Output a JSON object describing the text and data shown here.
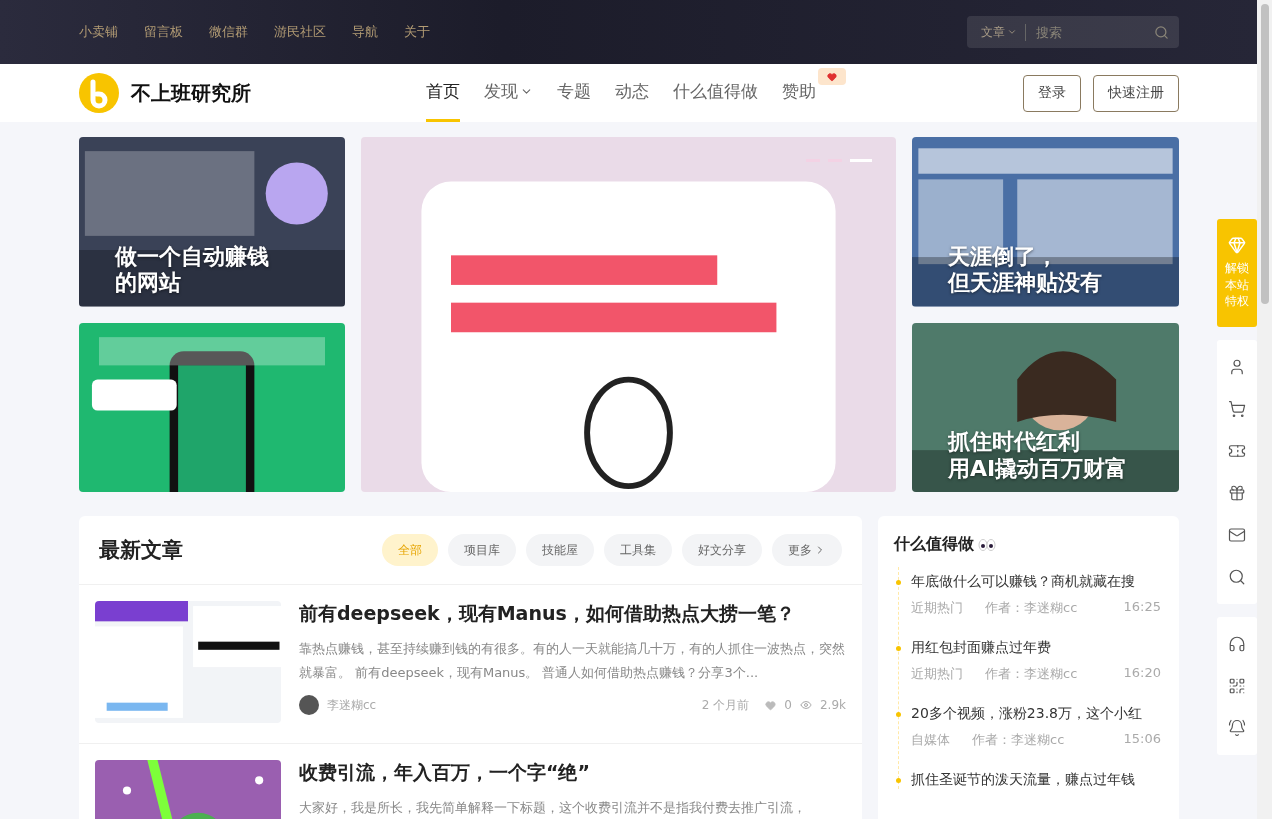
{
  "top_links": [
    {
      "label": "小卖铺"
    },
    {
      "label": "留言板"
    },
    {
      "label": "微信群"
    },
    {
      "label": "游民社区"
    },
    {
      "label": "导航"
    },
    {
      "label": "关于"
    }
  ],
  "search": {
    "scope": "文章",
    "placeholder": "搜索"
  },
  "brand": {
    "name": "不上班研究所"
  },
  "nav": [
    {
      "label": "首页",
      "selected": true,
      "dropdown": false,
      "badge": false
    },
    {
      "label": "发现",
      "selected": false,
      "dropdown": true,
      "badge": false
    },
    {
      "label": "专题",
      "selected": false,
      "dropdown": false,
      "badge": false
    },
    {
      "label": "动态",
      "selected": false,
      "dropdown": false,
      "badge": false
    },
    {
      "label": "什么值得做",
      "selected": false,
      "dropdown": false,
      "badge": false
    },
    {
      "label": "赞助",
      "selected": false,
      "dropdown": false,
      "badge": true
    }
  ],
  "auth_buttons": [
    {
      "label": "登录"
    },
    {
      "label": "快速注册"
    }
  ],
  "banners": {
    "left": [
      {
        "kind": "titled",
        "title_lines": [
          "做一个自动赚钱",
          "的网站"
        ]
      },
      {
        "kind": "picture"
      }
    ],
    "center": {
      "slides": [
        {
          "selected": false
        },
        {
          "selected": false
        },
        {
          "selected": true
        }
      ]
    },
    "right": [
      {
        "kind": "titled",
        "title_lines": [
          "天涯倒了，",
          "但天涯神贴没有"
        ]
      },
      {
        "kind": "titled",
        "title_lines": [
          "抓住时代红利",
          "用AI撬动百万财富"
        ]
      }
    ]
  },
  "latest": {
    "title": "最新文章",
    "filters": [
      {
        "label": "全部",
        "selected": true
      },
      {
        "label": "项目库",
        "selected": false
      },
      {
        "label": "技能屋",
        "selected": false
      },
      {
        "label": "工具集",
        "selected": false
      },
      {
        "label": "好文分享",
        "selected": false
      },
      {
        "label": "更多",
        "selected": false
      }
    ],
    "articles": [
      {
        "title": "前有deepseek，现有Manus，如何借助热点大捞一笔？",
        "excerpt": "靠热点赚钱，甚至持续赚到钱的有很多。有的人一天就能搞几十万，有的人抓住一波热点，突然就暴富。 前有deepseek，现有Manus。 普通人如何借助热点赚钱？分享3个...",
        "author": "李迷糊cc",
        "time": "2 个月前",
        "likes": "0",
        "views": "2.9k"
      },
      {
        "title": "收费引流，年入百万，一个字“绝”",
        "excerpt": "大家好，我是所长，我先简单解释一下标题，这个收费引流并不是指我付费去推广引流，"
      }
    ]
  },
  "worth": {
    "title": "什么值得做",
    "items": [
      {
        "title": "年底做什么可以赚钱？商机就藏在搜",
        "category": "近期热门",
        "author": "作者：李迷糊cc",
        "time": "16:25"
      },
      {
        "title": "用红包封面赚点过年费",
        "category": "近期热门",
        "author": "作者：李迷糊cc",
        "time": "16:20"
      },
      {
        "title": "20多个视频，涨粉23.8万，这个小红",
        "category": "自媒体",
        "author": "作者：李迷糊cc",
        "time": "15:06"
      },
      {
        "title": "抓住圣诞节的泼天流量，赚点过年钱"
      }
    ]
  },
  "float_bar": {
    "vip_label": "解锁本站特权"
  }
}
